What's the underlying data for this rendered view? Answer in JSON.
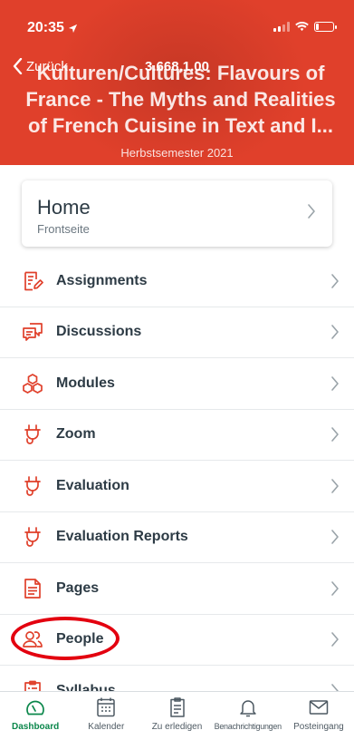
{
  "status": {
    "time": "20:35"
  },
  "nav": {
    "back_label": "Zurück",
    "course_code": "3.668,1.00"
  },
  "course": {
    "title_lines": [
      "Kulturen/Cultures: Flavours of",
      "France - The Myths and Realities",
      "of French Cuisine in Text and I..."
    ],
    "semester": "Herbstsemester 2021",
    "brand_color": "#e0402b"
  },
  "home": {
    "title": "Home",
    "subtitle": "Frontseite"
  },
  "menu": {
    "items": [
      {
        "label": "Assignments",
        "icon": "assignment-icon"
      },
      {
        "label": "Discussions",
        "icon": "discussion-icon"
      },
      {
        "label": "Modules",
        "icon": "modules-icon"
      },
      {
        "label": "Zoom",
        "icon": "plug-icon"
      },
      {
        "label": "Evaluation",
        "icon": "plug-icon"
      },
      {
        "label": "Evaluation Reports",
        "icon": "plug-icon"
      },
      {
        "label": "Pages",
        "icon": "page-icon"
      },
      {
        "label": "People",
        "icon": "people-icon"
      },
      {
        "label": "Syllabus",
        "icon": "syllabus-icon"
      }
    ],
    "icon_color": "#e0402b",
    "highlighted": "People"
  },
  "tabbar": {
    "items": [
      {
        "label": "Dashboard",
        "icon": "dashboard-icon",
        "active": true
      },
      {
        "label": "Kalender",
        "icon": "calendar-icon",
        "active": false
      },
      {
        "label": "Zu erledigen",
        "icon": "todo-icon",
        "active": false
      },
      {
        "label": "Benachrichtigungen",
        "icon": "bell-icon",
        "active": false
      },
      {
        "label": "Posteingang",
        "icon": "inbox-icon",
        "active": false
      }
    ],
    "active_color": "#0b874b"
  }
}
